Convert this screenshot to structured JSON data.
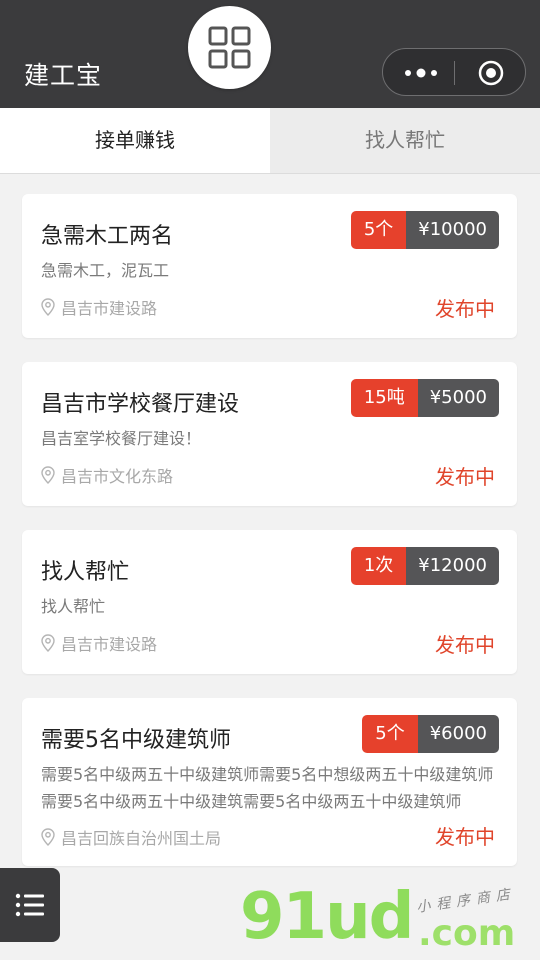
{
  "header": {
    "title": "建工宝"
  },
  "tabs": [
    {
      "label": "接单赚钱"
    },
    {
      "label": "找人帮忙"
    }
  ],
  "cards": [
    {
      "title": "急需木工两名",
      "desc": "急需木工，泥瓦工",
      "location": "昌吉市建设路",
      "qty": "5个",
      "price": "¥10000",
      "status": "发布中"
    },
    {
      "title": "昌吉市学校餐厅建设",
      "desc": "昌吉室学校餐厅建设！",
      "location": "昌吉市文化东路",
      "qty": "15吨",
      "price": "¥5000",
      "status": "发布中"
    },
    {
      "title": "找人帮忙",
      "desc": "找人帮忙",
      "location": "昌吉市建设路",
      "qty": "1次",
      "price": "¥12000",
      "status": "发布中"
    },
    {
      "title": "需要5名中级建筑师",
      "desc": "需要5名中级两五十中级建筑师需要5名中想级两五十中级建筑师需要5名中级两五十中级建筑需要5名中级两五十中级建筑师",
      "location": "昌吉回族自治州国土局",
      "qty": "5个",
      "price": "¥6000",
      "status": "发布中"
    }
  ],
  "watermark": {
    "brand": "91ud",
    "suffix": ".com",
    "tagline": "小程序商店"
  },
  "colors": {
    "topbar": "#3b3b3d",
    "accent_red": "#e6412c",
    "price_gray": "#555557",
    "status_red": "#e0452b"
  },
  "icons": {
    "home": "grid-icon",
    "more": "more-dots-icon",
    "close": "close-target-icon",
    "location": "location-pin-icon",
    "menu": "list-menu-icon"
  }
}
